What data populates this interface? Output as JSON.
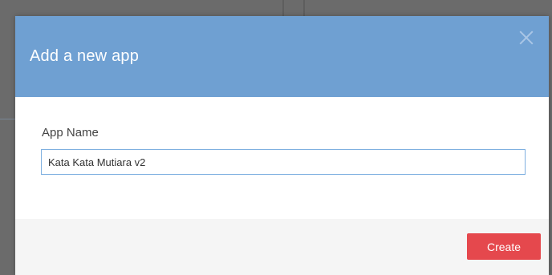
{
  "dialog": {
    "title": "Add a new app",
    "close_icon": "close-icon"
  },
  "form": {
    "app_name_label": "App Name",
    "app_name_value": "Kata Kata Mutiara v2"
  },
  "footer": {
    "create_label": "Create"
  },
  "colors": {
    "header": "#6fa0d2",
    "primary_button": "#e5484d",
    "input_border": "#7fb0e0",
    "footer_bg": "#f5f5f5"
  }
}
